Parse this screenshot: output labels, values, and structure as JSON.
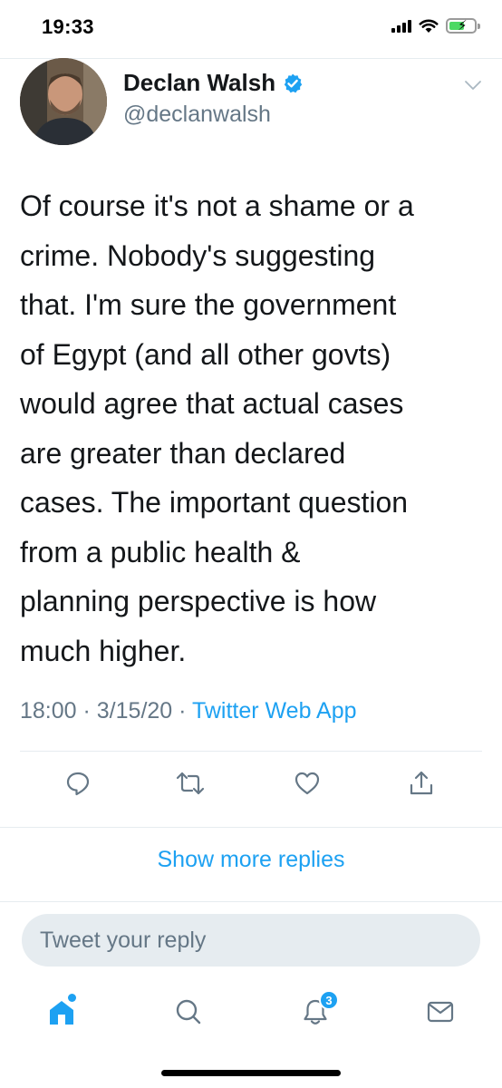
{
  "status_bar": {
    "time": "19:33",
    "icons": [
      "signal-icon",
      "wifi-icon",
      "battery-charging-icon"
    ]
  },
  "tweet": {
    "author": {
      "name": "Declan Walsh",
      "handle": "@declanwalsh",
      "verified": true
    },
    "text": "Of course it's not a shame or a\ncrime. Nobody's suggesting\nthat. I'm sure the government\nof Egypt (and all other govts)\nwould agree that actual cases\nare greater than declared\ncases. The important question\nfrom a public health &\nplanning perspective is how\nmuch higher.",
    "time": "18:00",
    "separator_1": " · ",
    "date": "3/15/20",
    "separator_2": " · ",
    "source": "Twitter Web App"
  },
  "actions": [
    "reply-icon",
    "retweet-icon",
    "like-icon",
    "share-icon"
  ],
  "show_more_replies": "Show more replies",
  "reply_input": {
    "placeholder": "Tweet your reply"
  },
  "tab_bar": {
    "tabs": [
      "home-icon",
      "search-icon",
      "notifications-icon",
      "messages-icon"
    ],
    "notifications_badge": "3"
  },
  "colors": {
    "accent": "#1da1f2",
    "text_primary": "#14171a",
    "text_secondary": "#657786",
    "divider": "#e6ecf0"
  }
}
